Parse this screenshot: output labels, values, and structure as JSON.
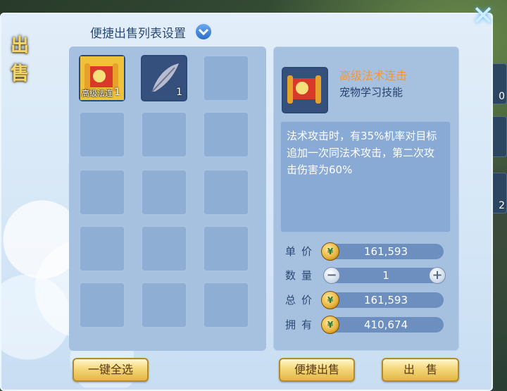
{
  "side_tab": {
    "chars": [
      "出",
      "售"
    ]
  },
  "close_icon": "✕",
  "header": {
    "title": "便捷出售列表设置",
    "dropdown_icon": "chevron-down-icon"
  },
  "grid": {
    "slots": [
      {
        "filled": true,
        "icon": "scroll-icon",
        "caption": "高级法连",
        "qty": "1"
      },
      {
        "filled": true,
        "icon": "feather-icon",
        "caption": "",
        "qty": "1"
      }
    ]
  },
  "item": {
    "name": "高级法术连击",
    "type": "宠物学习技能",
    "description": "法术攻击时，有35%机率对目标追加一次同法术攻击，第二次攻击伤害为60%"
  },
  "price": {
    "unit_label": "单价",
    "unit_value": "161,593",
    "qty_label": "数量",
    "qty_value": "1",
    "total_label": "总价",
    "total_value": "161,593",
    "owned_label": "拥有",
    "owned_value": "410,674"
  },
  "buttons": {
    "select_all": "一键全选",
    "quick_sell": "便捷出售",
    "sell": "出　售"
  },
  "right_edge": [
    "0",
    "",
    "2"
  ]
}
